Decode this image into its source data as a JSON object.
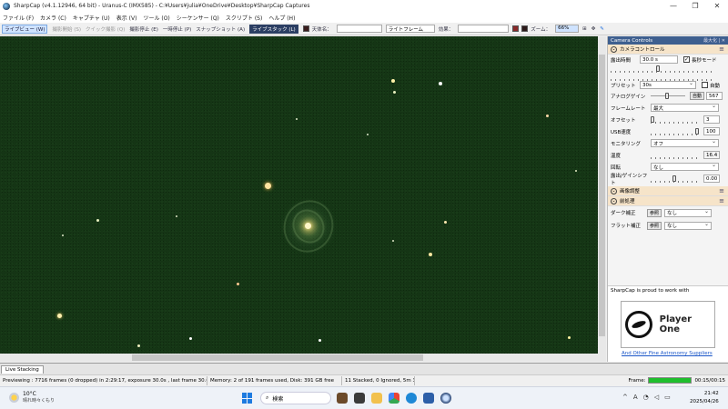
{
  "window": {
    "title": "SharpCap (v4.1.12946, 64 bit) - Uranus-C (IMX585) - C:¥Users¥julia¥OneDrive¥Desktop¥SharpCap Captures",
    "controls": [
      "—",
      "❐",
      "✕"
    ]
  },
  "menu": [
    "ファイル (F)",
    "カメラ (C)",
    "キャプチャ (U)",
    "表示 (V)",
    "ツール (O)",
    "シーケンサー (Q)",
    "スクリプト (S)",
    "ヘルプ (H)"
  ],
  "toolbar": {
    "live_view": "ライブビュー (W)",
    "capture_start": "撮影開始 (S)",
    "quick_capture": "クイック撮影 (Q)",
    "capture_stop": "撮影停止 (E)",
    "pause": "一時停止 (P)",
    "snapshot": "スナップショット (A)",
    "live_stack": "ライブスタック (L)",
    "object_name_label": "天体名：",
    "frame_type": "ライトフレーム",
    "effect_label": "効果：",
    "zoom_label": "ズーム：",
    "zoom_value": "66%",
    "colors": {
      "swatch1": "#8a2a2a",
      "swatch2": "#2c1a1a"
    }
  },
  "panel": {
    "title": "Camera Controls",
    "title_controls": "最大化 | ✕",
    "camera_section": "カメラコントロール",
    "exposure_label": "露出時間",
    "exposure_value": "30.0 s",
    "long_mode_label": "長秒モード",
    "preset_label": "プリセット",
    "preset_value": "30s",
    "auto_label": "自動",
    "analog_gain_label": "アナログゲイン",
    "auto_button": "自動",
    "gain_value": "567",
    "frame_rate_label": "フレームレート",
    "frame_rate_value": "最大",
    "offset_label": "オフセット",
    "offset_value": "3",
    "usb_label": "USB速度",
    "usb_value": "100",
    "monitoring_label": "モニタリング",
    "monitoring_value": "オフ",
    "temp_label": "温度",
    "temp_value": "16.4",
    "rotation_label": "回転",
    "rotation_value": "なし",
    "exposure_shift_label": "露出/ゲインシフト",
    "exposure_shift_value": "0.00",
    "image_adjust_section": "画像調整",
    "preprocess_section": "前処理",
    "dark_label": "ダーク補正",
    "flat_label": "フラット補正",
    "browse_button": "参照",
    "none_value": "なし",
    "promo_text": "SharpCap is proud to work with",
    "promo_brand": "Player One",
    "promo_link": "And Other Fine Astronomy Suppliers"
  },
  "bottom": {
    "tab": "Live Stacking",
    "status_preview": "Previewing : 7716 frames (0 dropped) in 2:29:17, exposure 30.0s , last frame 30.0s",
    "status_memory": "Memory: 2 of 191 frames used, Disk: 391 GB free",
    "status_stack": "11 Stacked, 0 Ignored, 5m 30s",
    "frame_label": "Frame:",
    "frame_progress": 1.0,
    "frame_time": "00:15/00:15"
  },
  "taskbar": {
    "weather_temp": "10°C",
    "weather_desc": "晴れ時々くもり",
    "search_placeholder": "検索",
    "tray_icons": [
      "^",
      "A",
      "wifi",
      "speaker",
      "battery"
    ],
    "time": "21:42",
    "date": "2025/04/26"
  }
}
